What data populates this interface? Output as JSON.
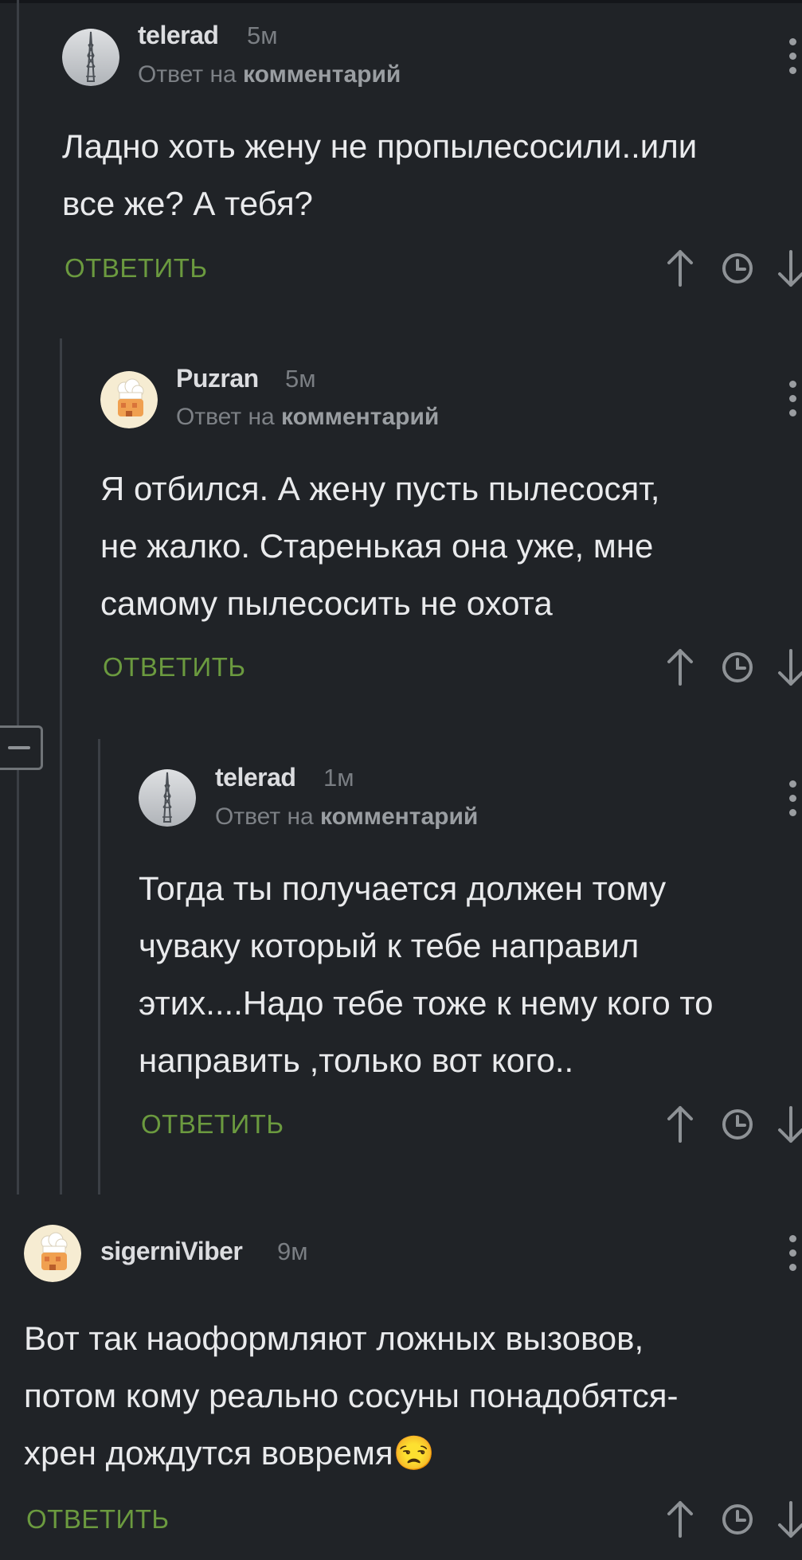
{
  "comments": [
    {
      "author": "telerad",
      "time": "5м",
      "reply_prefix": "Ответ на ",
      "reply_link": "комментарий",
      "lines": [
        "Ладно хоть жену не пропылесосили..или",
        "все же? А тебя?"
      ],
      "reply_label": "ОТВЕТИТЬ",
      "avatar": "tower-avatar"
    },
    {
      "author": "Puzran",
      "time": "5м",
      "reply_prefix": "Ответ на ",
      "reply_link": "комментарий",
      "lines": [
        "Я отбился. А жену пусть пылесосят,",
        "не жалко. Старенькая она уже, мне",
        "самому пылесосить не охота"
      ],
      "reply_label": "ОТВЕТИТЬ",
      "avatar": "chef-avatar"
    },
    {
      "author": "telerad",
      "time": "1м",
      "reply_prefix": "Ответ на ",
      "reply_link": "комментарий",
      "lines": [
        "Тогда ты получается должен тому",
        "чуваку который к тебе направил",
        "этих....Надо тебе тоже к нему кого то",
        "направить ,только вот кого.."
      ],
      "reply_label": "ОТВЕТИТЬ",
      "avatar": "tower-avatar"
    },
    {
      "author": "sigerniViber",
      "time": "9м",
      "lines": [
        "Вот так наоформляют ложных вызовов,",
        "потом кому реально сосуны понадобятся-",
        "хрен дождутся вовремя😒"
      ],
      "reply_label": "ОТВЕТИТЬ",
      "avatar": "chef-avatar"
    }
  ],
  "icons": {
    "upvote": "arrow-up-icon",
    "save": "clock-icon",
    "downvote": "arrow-down-icon",
    "menu": "more-vertical-icon",
    "collapse": "collapse-minus-icon"
  },
  "colors": {
    "background": "#202327",
    "reply_green": "#6b9a3f",
    "thread_line": "#3b3f45"
  }
}
